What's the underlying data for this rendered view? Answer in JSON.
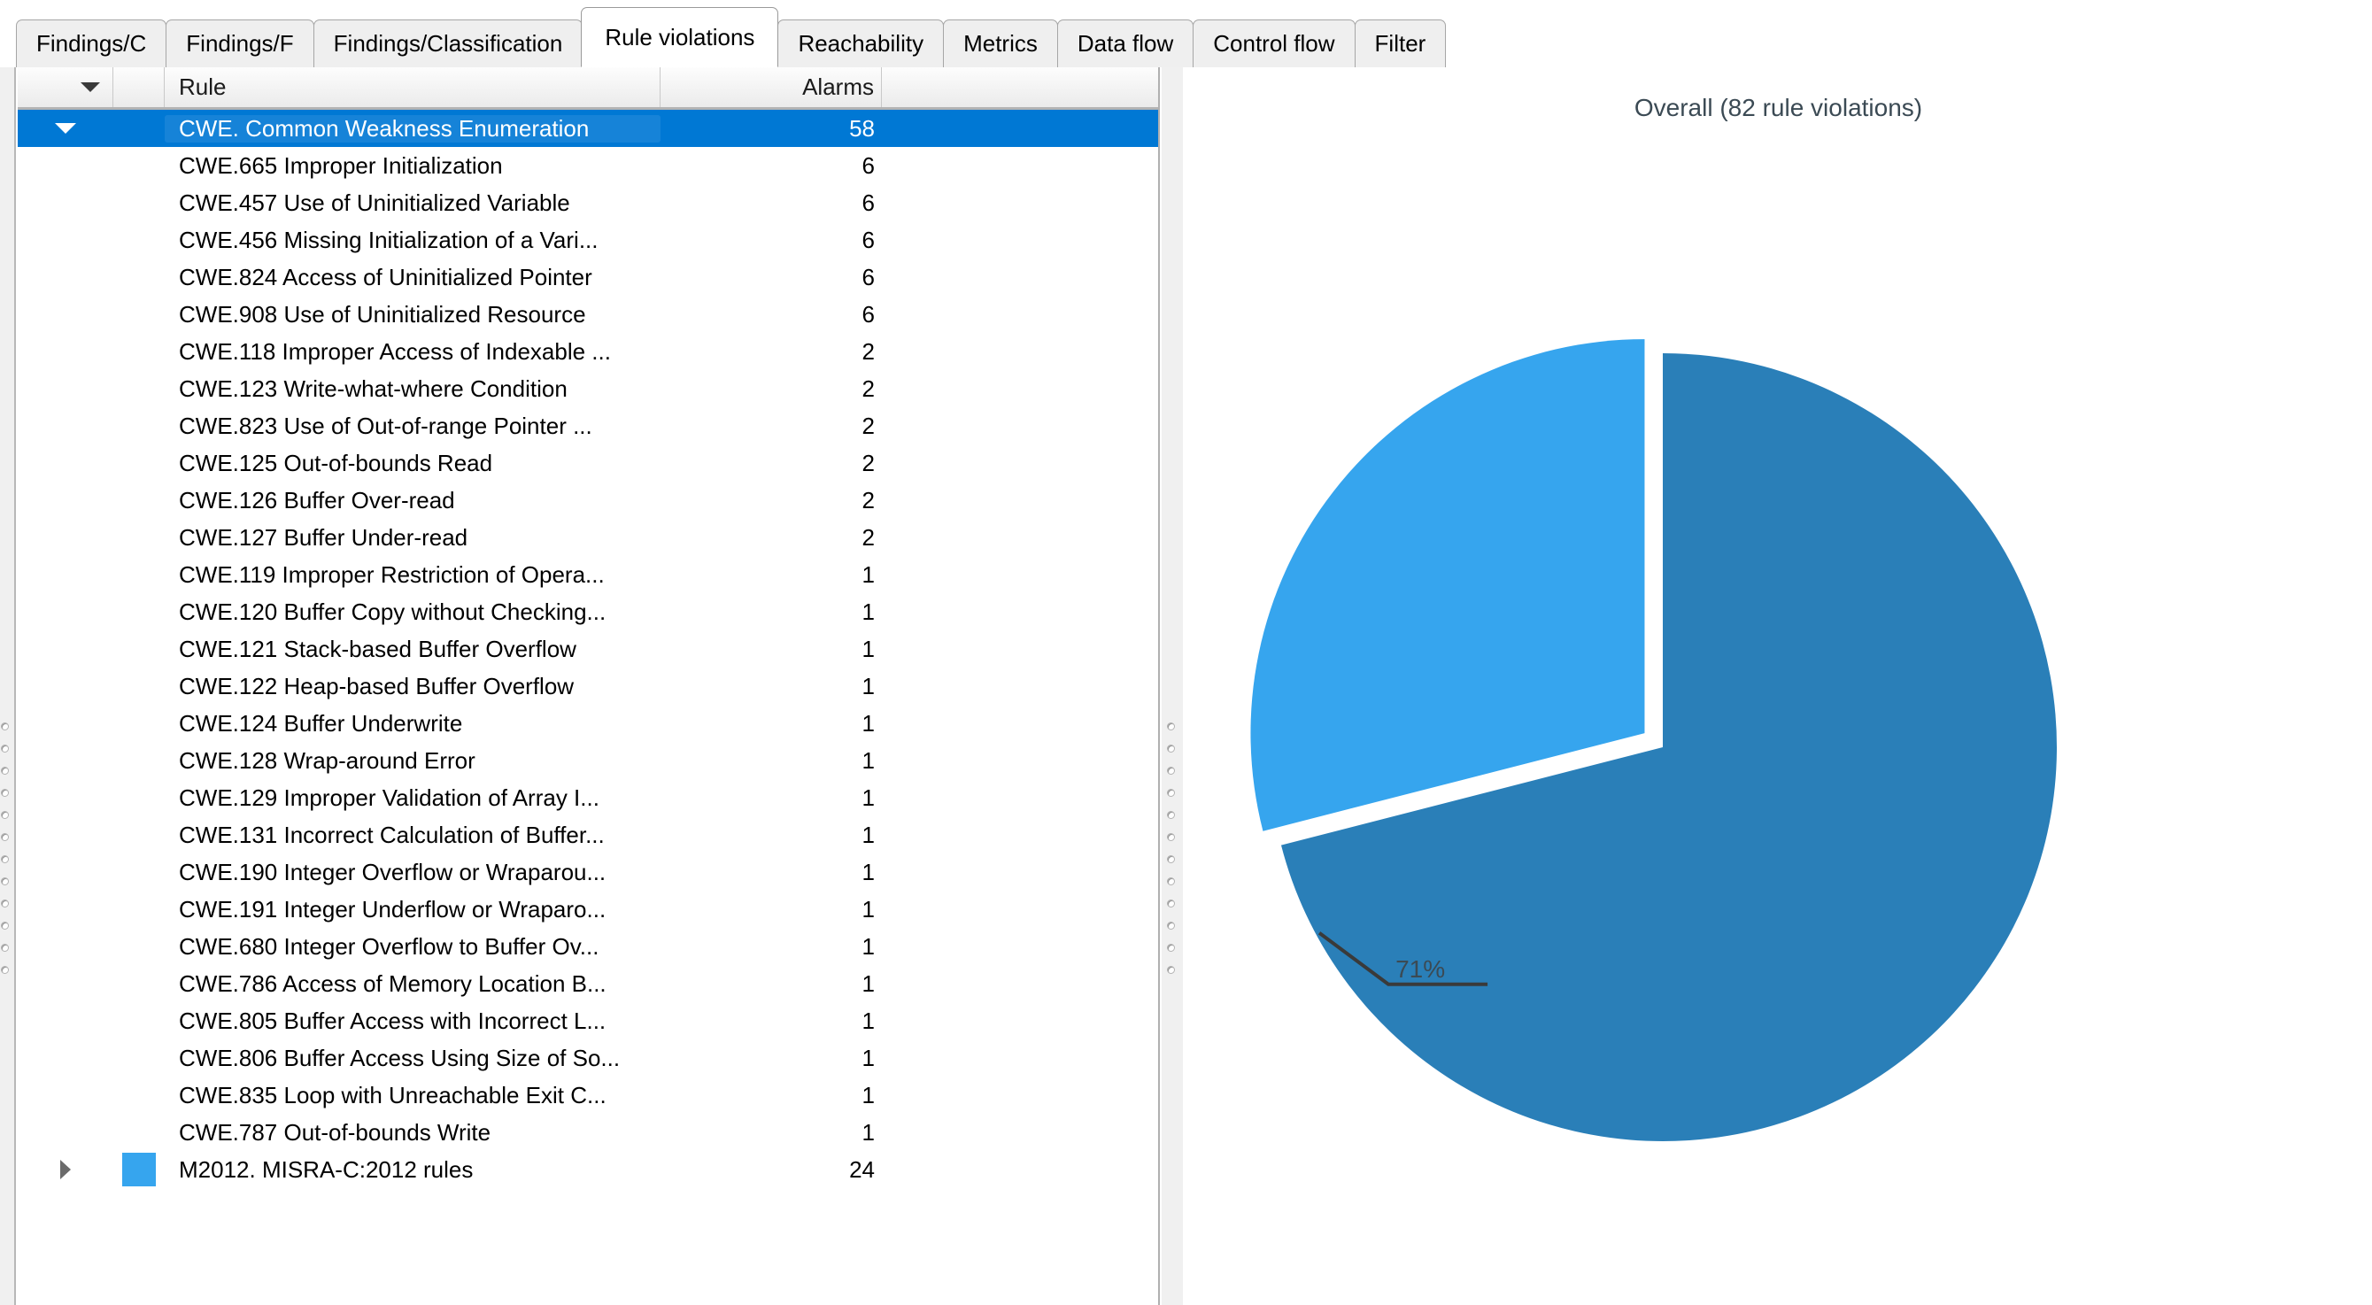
{
  "tabs": [
    {
      "label": "Findings/C",
      "active": false
    },
    {
      "label": "Findings/F",
      "active": false
    },
    {
      "label": "Findings/Classification",
      "active": false
    },
    {
      "label": "Rule violations",
      "active": true
    },
    {
      "label": "Reachability",
      "active": false
    },
    {
      "label": "Metrics",
      "active": false
    },
    {
      "label": "Data flow",
      "active": false
    },
    {
      "label": "Control flow",
      "active": false
    },
    {
      "label": "Filter",
      "active": false
    }
  ],
  "table": {
    "columns": {
      "rule": "Rule",
      "alarms": "Alarms"
    },
    "rows": [
      {
        "rule": "CWE. Common Weakness Enumeration",
        "alarms": "58",
        "selected": true,
        "expander": "down",
        "swatch": null
      },
      {
        "rule": "CWE.665 Improper Initialization",
        "alarms": "6",
        "selected": false,
        "expander": null,
        "swatch": null
      },
      {
        "rule": "CWE.457 Use of Uninitialized Variable",
        "alarms": "6",
        "selected": false,
        "expander": null,
        "swatch": null
      },
      {
        "rule": "CWE.456 Missing Initialization of a Vari...",
        "alarms": "6",
        "selected": false,
        "expander": null,
        "swatch": null
      },
      {
        "rule": "CWE.824 Access of Uninitialized Pointer",
        "alarms": "6",
        "selected": false,
        "expander": null,
        "swatch": null
      },
      {
        "rule": "CWE.908 Use of Uninitialized Resource",
        "alarms": "6",
        "selected": false,
        "expander": null,
        "swatch": null
      },
      {
        "rule": "CWE.118 Improper Access of Indexable ...",
        "alarms": "2",
        "selected": false,
        "expander": null,
        "swatch": null
      },
      {
        "rule": "CWE.123 Write-what-where Condition",
        "alarms": "2",
        "selected": false,
        "expander": null,
        "swatch": null
      },
      {
        "rule": "CWE.823 Use of Out-of-range Pointer ...",
        "alarms": "2",
        "selected": false,
        "expander": null,
        "swatch": null
      },
      {
        "rule": "CWE.125 Out-of-bounds Read",
        "alarms": "2",
        "selected": false,
        "expander": null,
        "swatch": null
      },
      {
        "rule": "CWE.126 Buffer Over-read",
        "alarms": "2",
        "selected": false,
        "expander": null,
        "swatch": null
      },
      {
        "rule": "CWE.127 Buffer Under-read",
        "alarms": "2",
        "selected": false,
        "expander": null,
        "swatch": null
      },
      {
        "rule": "CWE.119 Improper Restriction of Opera...",
        "alarms": "1",
        "selected": false,
        "expander": null,
        "swatch": null
      },
      {
        "rule": "CWE.120 Buffer Copy without Checking...",
        "alarms": "1",
        "selected": false,
        "expander": null,
        "swatch": null
      },
      {
        "rule": "CWE.121 Stack-based Buffer Overflow",
        "alarms": "1",
        "selected": false,
        "expander": null,
        "swatch": null
      },
      {
        "rule": "CWE.122 Heap-based Buffer Overflow",
        "alarms": "1",
        "selected": false,
        "expander": null,
        "swatch": null
      },
      {
        "rule": "CWE.124 Buffer Underwrite",
        "alarms": "1",
        "selected": false,
        "expander": null,
        "swatch": null
      },
      {
        "rule": "CWE.128 Wrap-around Error",
        "alarms": "1",
        "selected": false,
        "expander": null,
        "swatch": null
      },
      {
        "rule": "CWE.129 Improper Validation of Array I...",
        "alarms": "1",
        "selected": false,
        "expander": null,
        "swatch": null
      },
      {
        "rule": "CWE.131 Incorrect Calculation of Buffer...",
        "alarms": "1",
        "selected": false,
        "expander": null,
        "swatch": null
      },
      {
        "rule": "CWE.190 Integer Overflow or Wraparou...",
        "alarms": "1",
        "selected": false,
        "expander": null,
        "swatch": null
      },
      {
        "rule": "CWE.191 Integer Underflow or Wraparo...",
        "alarms": "1",
        "selected": false,
        "expander": null,
        "swatch": null
      },
      {
        "rule": "CWE.680 Integer Overflow to Buffer Ov...",
        "alarms": "1",
        "selected": false,
        "expander": null,
        "swatch": null
      },
      {
        "rule": "CWE.786 Access of Memory Location B...",
        "alarms": "1",
        "selected": false,
        "expander": null,
        "swatch": null
      },
      {
        "rule": "CWE.805 Buffer Access with Incorrect L...",
        "alarms": "1",
        "selected": false,
        "expander": null,
        "swatch": null
      },
      {
        "rule": "CWE.806 Buffer Access Using Size of So...",
        "alarms": "1",
        "selected": false,
        "expander": null,
        "swatch": null
      },
      {
        "rule": "CWE.835 Loop with Unreachable Exit C...",
        "alarms": "1",
        "selected": false,
        "expander": null,
        "swatch": null
      },
      {
        "rule": "CWE.787 Out-of-bounds Write",
        "alarms": "1",
        "selected": false,
        "expander": null,
        "swatch": null
      },
      {
        "rule": "M2012. MISRA-C:2012 rules",
        "alarms": "24",
        "selected": false,
        "expander": "right",
        "swatch": "#36a5ee"
      }
    ]
  },
  "chart_data": {
    "type": "pie",
    "title": "Overall (82 rule violations)",
    "total": 82,
    "legend": "none",
    "labels": [
      "CWE. Common Weakness Enumeration",
      "M2012. MISRA-C:2012 rules"
    ],
    "values": [
      58,
      24
    ],
    "percents": [
      71,
      29
    ],
    "colors": [
      "#2a7fb8",
      "#36a5ee"
    ],
    "exploded": [
      false,
      true
    ],
    "annotations": [
      {
        "text": "71%",
        "slice": 0,
        "leader": true
      }
    ],
    "start_angle_deg": 0,
    "direction": "clockwise"
  },
  "colors": {
    "selection": "#0078d4",
    "slice_dark": "#2a7fb8",
    "slice_light": "#36a5ee",
    "header_text": "#3b4a54"
  }
}
